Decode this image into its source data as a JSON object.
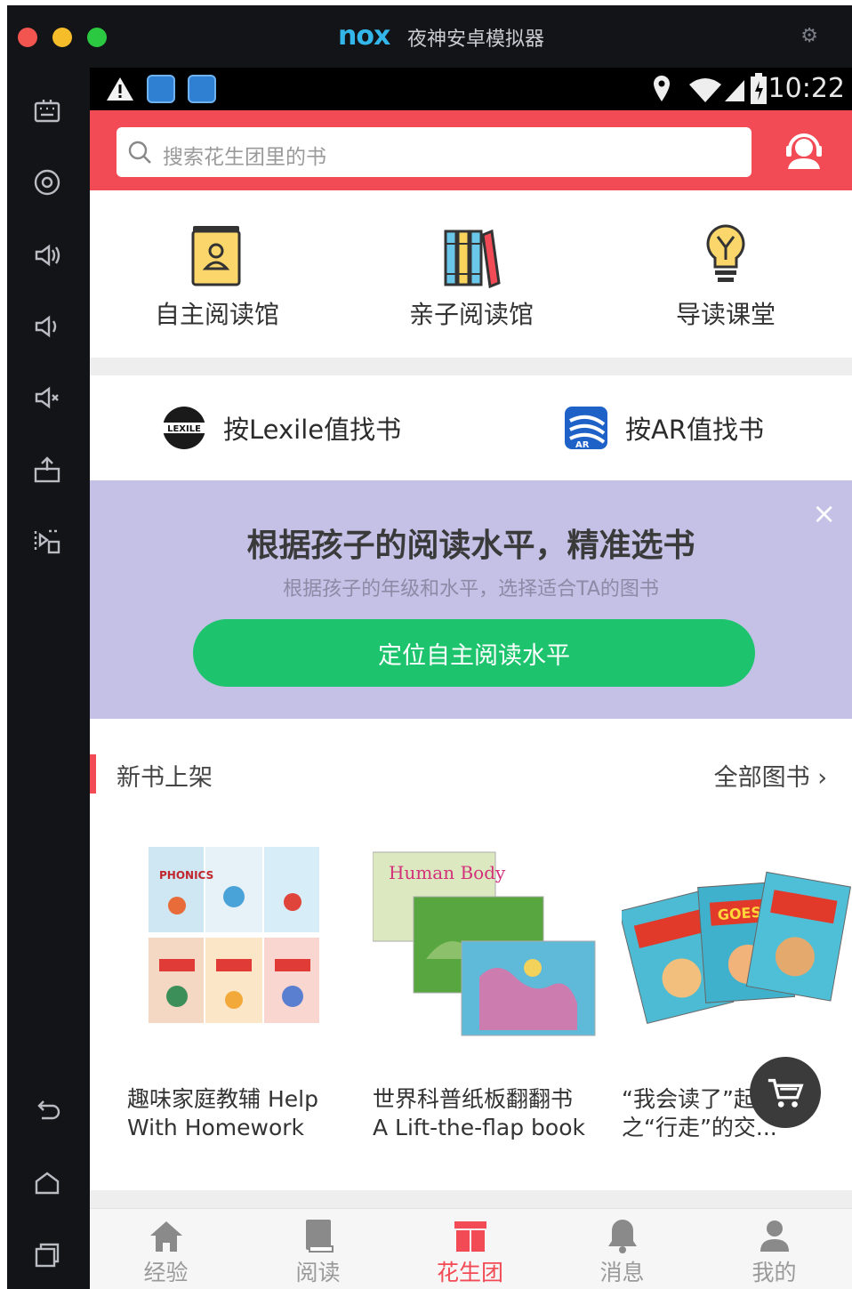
{
  "emulator": {
    "logo": "nox",
    "title": "夜神安卓模拟器",
    "traffic_lights": [
      "#f2544f",
      "#f6bd2a",
      "#2bc941"
    ],
    "sidebar_icons": [
      "keyboard-icon",
      "location-icon",
      "volume-up-icon",
      "volume-down-icon",
      "mute-icon",
      "apk-install-icon",
      "screen-record-icon",
      "back-icon",
      "home-icon",
      "recent-apps-icon"
    ]
  },
  "statusbar": {
    "time": "10:22"
  },
  "search": {
    "placeholder": "搜索花生团里的书"
  },
  "categories": [
    {
      "label": "自主阅读馆",
      "icon": "book-person-icon"
    },
    {
      "label": "亲子阅读馆",
      "icon": "bookshelf-icon"
    },
    {
      "label": "导读课堂",
      "icon": "lightbulb-icon"
    }
  ],
  "finders": [
    {
      "label": "按Lexile值找书",
      "badge": "LEXILE",
      "icon": "lexile-logo-icon"
    },
    {
      "label": "按AR值找书",
      "badge": "AR",
      "icon": "ar-logo-icon"
    }
  ],
  "promo": {
    "title": "根据孩子的阅读水平，精准选书",
    "subtitle": "根据孩子的年级和水平，选择适合TA的图书",
    "button": "定位自主阅读水平",
    "close": "×"
  },
  "section": {
    "title": "新书上架",
    "more": "全部图书 ›"
  },
  "books": [
    {
      "title_line1": "趣味家庭教辅 Help",
      "title_line2": "With Homework",
      "cover_text": "PHONICS"
    },
    {
      "title_line1": "世界科普纸板翻翻书",
      "title_line2": "A Lift-the-flap book",
      "cover_text": "Human Body"
    },
    {
      "title_line1": "“我会读了”起",
      "title_line2": "之“行走”的交...",
      "cover_text": "GOES"
    }
  ],
  "tabs": [
    {
      "label": "经验",
      "icon": "home-icon",
      "active": false
    },
    {
      "label": "阅读",
      "icon": "book-icon",
      "active": false
    },
    {
      "label": "花生团",
      "icon": "gift-box-icon",
      "active": true
    },
    {
      "label": "消息",
      "icon": "bell-icon",
      "active": false
    },
    {
      "label": "我的",
      "icon": "user-icon",
      "active": false
    }
  ],
  "colors": {
    "brand_red": "#f24b55",
    "promo_bg": "#c4c0e6",
    "cta_green": "#1ec46d"
  }
}
